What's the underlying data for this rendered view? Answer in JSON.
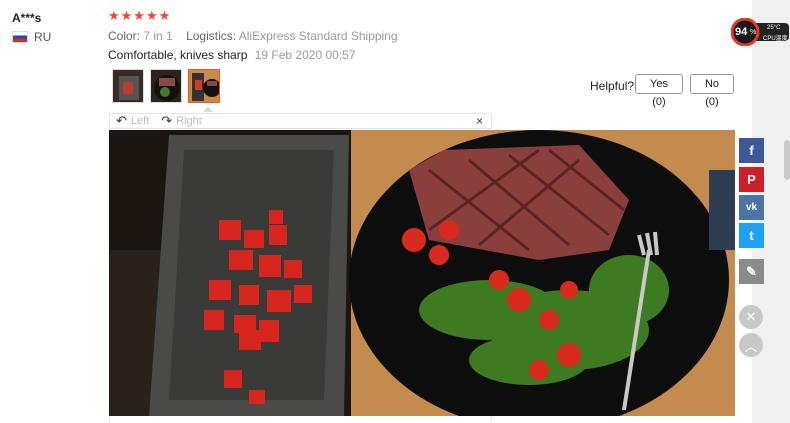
{
  "reviewer": {
    "name": "A***s",
    "country": "RU"
  },
  "rating": {
    "stars": "★★★★★"
  },
  "meta": {
    "color_label": "Color:",
    "color_value": "7 in 1",
    "logistics_label": "Logistics:",
    "logistics_value": "AliExpress Standard Shipping"
  },
  "review": {
    "text": "Comfortable, knives sharp",
    "date": "19 Feb 2020 00:57"
  },
  "helpful": {
    "label": "Helpful?",
    "yes": "Yes (0)",
    "no": "No (0)"
  },
  "viewer": {
    "left": "Left",
    "right": "Right",
    "close": "×"
  },
  "cpu": {
    "percent": "94",
    "unit": "%",
    "temp": "25°C",
    "label": "CPU温度"
  },
  "social": {
    "facebook": "f",
    "pinterest": "P",
    "vk": "vk",
    "twitter": "t",
    "edit": "✎"
  },
  "icons": {
    "close": "✕",
    "up": "︿"
  }
}
